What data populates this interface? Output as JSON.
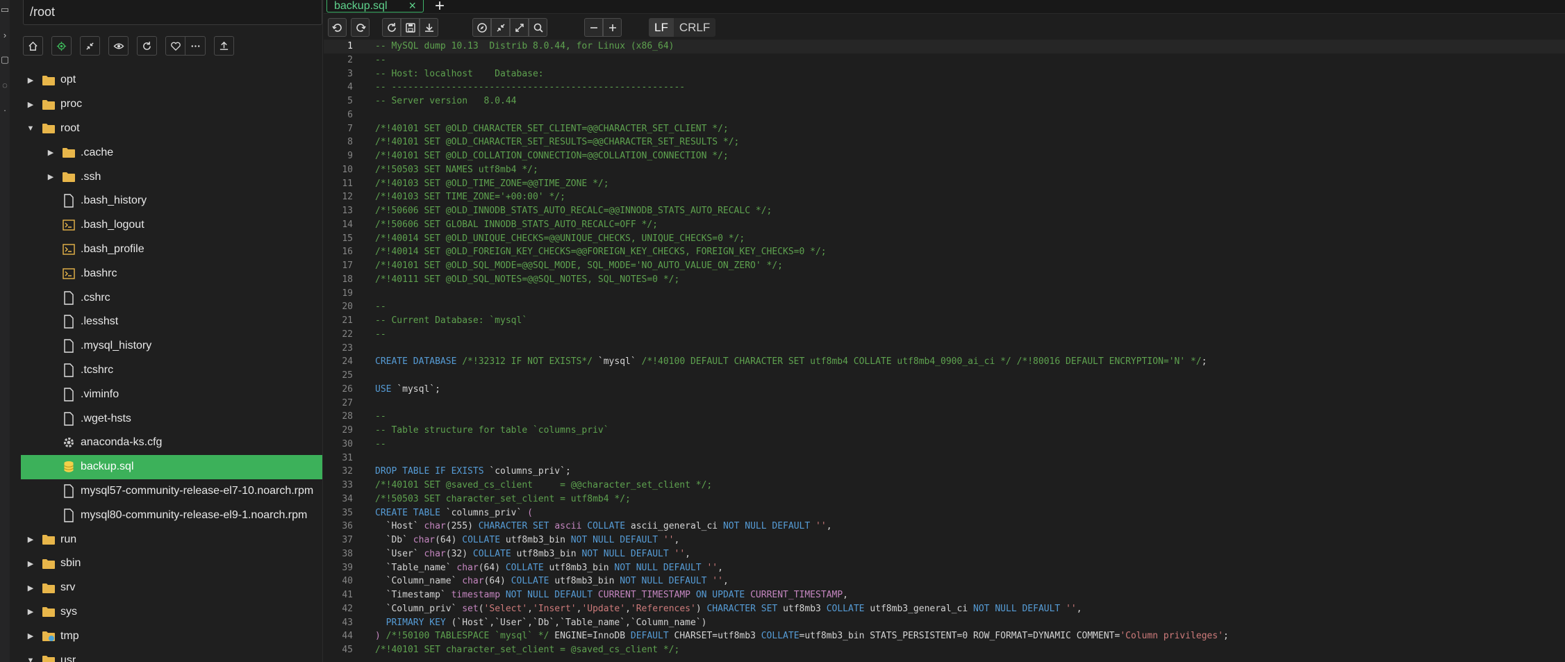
{
  "sidebar": {
    "path": "/root",
    "toolbar": [
      {
        "name": "home-icon",
        "glyph": "home"
      },
      {
        "name": "locate-icon",
        "glyph": "target"
      },
      {
        "name": "collapse-icon",
        "glyph": "collapse"
      },
      {
        "name": "eye-icon",
        "glyph": "eye"
      },
      {
        "name": "refresh-icon",
        "glyph": "refresh"
      },
      {
        "name": "heart-icon",
        "glyph": "heart"
      },
      {
        "name": "more-icon",
        "glyph": "more"
      },
      {
        "name": "upload-icon",
        "glyph": "upload"
      }
    ],
    "tree": [
      {
        "label": "opt",
        "type": "folder",
        "depth": 0,
        "expanded": false
      },
      {
        "label": "proc",
        "type": "folder",
        "depth": 0,
        "expanded": false
      },
      {
        "label": "root",
        "type": "folder",
        "depth": 0,
        "expanded": true
      },
      {
        "label": ".cache",
        "type": "folder",
        "depth": 1,
        "expanded": false
      },
      {
        "label": ".ssh",
        "type": "folder",
        "depth": 1,
        "expanded": false
      },
      {
        "label": ".bash_history",
        "type": "file",
        "depth": 1
      },
      {
        "label": ".bash_logout",
        "type": "shell",
        "depth": 1
      },
      {
        "label": ".bash_profile",
        "type": "shell",
        "depth": 1
      },
      {
        "label": ".bashrc",
        "type": "shell",
        "depth": 1
      },
      {
        "label": ".cshrc",
        "type": "file",
        "depth": 1
      },
      {
        "label": ".lesshst",
        "type": "file",
        "depth": 1
      },
      {
        "label": ".mysql_history",
        "type": "file",
        "depth": 1
      },
      {
        "label": ".tcshrc",
        "type": "file",
        "depth": 1
      },
      {
        "label": ".viminfo",
        "type": "file",
        "depth": 1
      },
      {
        "label": ".wget-hsts",
        "type": "file",
        "depth": 1
      },
      {
        "label": "anaconda-ks.cfg",
        "type": "config",
        "depth": 1
      },
      {
        "label": "backup.sql",
        "type": "database",
        "depth": 1,
        "selected": true
      },
      {
        "label": "mysql57-community-release-el7-10.noarch.rpm",
        "type": "file",
        "depth": 1
      },
      {
        "label": "mysql80-community-release-el9-1.noarch.rpm",
        "type": "file",
        "depth": 1
      },
      {
        "label": "run",
        "type": "folder",
        "depth": 0,
        "expanded": false
      },
      {
        "label": "sbin",
        "type": "folder",
        "depth": 0,
        "expanded": false
      },
      {
        "label": "srv",
        "type": "folder",
        "depth": 0,
        "expanded": false
      },
      {
        "label": "sys",
        "type": "folder",
        "depth": 0,
        "expanded": false
      },
      {
        "label": "tmp",
        "type": "folder-special",
        "depth": 0,
        "expanded": false
      },
      {
        "label": "usr",
        "type": "folder",
        "depth": 0,
        "expanded": true
      }
    ]
  },
  "editor": {
    "tab": {
      "label": "backup.sql"
    },
    "eol": {
      "lf": "LF",
      "crlf": "CRLF",
      "active": "LF"
    },
    "current_line": 1,
    "lines": [
      [
        [
          "c",
          "-- MySQL dump 10.13  Distrib 8.0.44, for Linux (x86_64)"
        ]
      ],
      [
        [
          "c",
          "--"
        ]
      ],
      [
        [
          "c",
          "-- Host: localhost    Database:"
        ]
      ],
      [
        [
          "c",
          "-- ------------------------------------------------------"
        ]
      ],
      [
        [
          "c",
          "-- Server version   8.0.44"
        ]
      ],
      [],
      [
        [
          "c",
          "/*!40101 SET @OLD_CHARACTER_SET_CLIENT=@@CHARACTER_SET_CLIENT */;"
        ]
      ],
      [
        [
          "c",
          "/*!40101 SET @OLD_CHARACTER_SET_RESULTS=@@CHARACTER_SET_RESULTS */;"
        ]
      ],
      [
        [
          "c",
          "/*!40101 SET @OLD_COLLATION_CONNECTION=@@COLLATION_CONNECTION */;"
        ]
      ],
      [
        [
          "c",
          "/*!50503 SET NAMES utf8mb4 */;"
        ]
      ],
      [
        [
          "c",
          "/*!40103 SET @OLD_TIME_ZONE=@@TIME_ZONE */;"
        ]
      ],
      [
        [
          "c",
          "/*!40103 SET TIME_ZONE='+00:00' */;"
        ]
      ],
      [
        [
          "c",
          "/*!50606 SET @OLD_INNODB_STATS_AUTO_RECALC=@@INNODB_STATS_AUTO_RECALC */;"
        ]
      ],
      [
        [
          "c",
          "/*!50606 SET GLOBAL INNODB_STATS_AUTO_RECALC=OFF */;"
        ]
      ],
      [
        [
          "c",
          "/*!40014 SET @OLD_UNIQUE_CHECKS=@@UNIQUE_CHECKS, UNIQUE_CHECKS=0 */;"
        ]
      ],
      [
        [
          "c",
          "/*!40014 SET @OLD_FOREIGN_KEY_CHECKS=@@FOREIGN_KEY_CHECKS, FOREIGN_KEY_CHECKS=0 */;"
        ]
      ],
      [
        [
          "c",
          "/*!40101 SET @OLD_SQL_MODE=@@SQL_MODE, SQL_MODE='NO_AUTO_VALUE_ON_ZERO' */;"
        ]
      ],
      [
        [
          "c",
          "/*!40111 SET @OLD_SQL_NOTES=@@SQL_NOTES, SQL_NOTES=0 */;"
        ]
      ],
      [],
      [
        [
          "c",
          "--"
        ]
      ],
      [
        [
          "c",
          "-- Current Database: `mysql`"
        ]
      ],
      [
        [
          "c",
          "--"
        ]
      ],
      [],
      [
        [
          "k",
          "CREATE DATABASE "
        ],
        [
          "c",
          "/*!32312 IF NOT EXISTS*/ "
        ],
        [
          "t",
          "`mysql` "
        ],
        [
          "c",
          "/*!40100 DEFAULT CHARACTER SET utf8mb4 COLLATE utf8mb4_0900_ai_ci */ /*!80016 DEFAULT ENCRYPTION='N' */"
        ],
        [
          "t",
          ";"
        ]
      ],
      [],
      [
        [
          "k",
          "USE "
        ],
        [
          "t",
          "`mysql`;"
        ]
      ],
      [],
      [
        [
          "c",
          "--"
        ]
      ],
      [
        [
          "c",
          "-- Table structure for table `columns_priv`"
        ]
      ],
      [
        [
          "c",
          "--"
        ]
      ],
      [],
      [
        [
          "k",
          "DROP TABLE IF EXISTS "
        ],
        [
          "t",
          "`columns_priv`;"
        ]
      ],
      [
        [
          "c",
          "/*!40101 SET @saved_cs_client     = @@character_set_client */;"
        ]
      ],
      [
        [
          "c",
          "/*!50503 SET character_set_client = utf8mb4 */;"
        ]
      ],
      [
        [
          "k",
          "CREATE TABLE "
        ],
        [
          "t",
          "`columns_priv` "
        ],
        [
          "p",
          "("
        ]
      ],
      [
        [
          "t",
          "  `Host` "
        ],
        [
          "p",
          "char"
        ],
        [
          "t",
          "(255) "
        ],
        [
          "k",
          "CHARACTER SET "
        ],
        [
          "p",
          "ascii "
        ],
        [
          "k",
          "COLLATE "
        ],
        [
          "t",
          "ascii_general_ci "
        ],
        [
          "k",
          "NOT NULL DEFAULT "
        ],
        [
          "s",
          "''"
        ],
        [
          "t",
          ","
        ]
      ],
      [
        [
          "t",
          "  `Db` "
        ],
        [
          "p",
          "char"
        ],
        [
          "t",
          "(64) "
        ],
        [
          "k",
          "COLLATE "
        ],
        [
          "t",
          "utf8mb3_bin "
        ],
        [
          "k",
          "NOT NULL DEFAULT "
        ],
        [
          "s",
          "''"
        ],
        [
          "t",
          ","
        ]
      ],
      [
        [
          "t",
          "  `User` "
        ],
        [
          "p",
          "char"
        ],
        [
          "t",
          "(32) "
        ],
        [
          "k",
          "COLLATE "
        ],
        [
          "t",
          "utf8mb3_bin "
        ],
        [
          "k",
          "NOT NULL DEFAULT "
        ],
        [
          "s",
          "''"
        ],
        [
          "t",
          ","
        ]
      ],
      [
        [
          "t",
          "  `Table_name` "
        ],
        [
          "p",
          "char"
        ],
        [
          "t",
          "(64) "
        ],
        [
          "k",
          "COLLATE "
        ],
        [
          "t",
          "utf8mb3_bin "
        ],
        [
          "k",
          "NOT NULL DEFAULT "
        ],
        [
          "s",
          "''"
        ],
        [
          "t",
          ","
        ]
      ],
      [
        [
          "t",
          "  `Column_name` "
        ],
        [
          "p",
          "char"
        ],
        [
          "t",
          "(64) "
        ],
        [
          "k",
          "COLLATE "
        ],
        [
          "t",
          "utf8mb3_bin "
        ],
        [
          "k",
          "NOT NULL DEFAULT "
        ],
        [
          "s",
          "''"
        ],
        [
          "t",
          ","
        ]
      ],
      [
        [
          "t",
          "  `Timestamp` "
        ],
        [
          "p",
          "timestamp "
        ],
        [
          "k",
          "NOT NULL DEFAULT "
        ],
        [
          "p",
          "CURRENT_TIMESTAMP "
        ],
        [
          "k",
          "ON UPDATE "
        ],
        [
          "p",
          "CURRENT_TIMESTAMP"
        ],
        [
          "t",
          ","
        ]
      ],
      [
        [
          "t",
          "  `Column_priv` "
        ],
        [
          "p",
          "set"
        ],
        [
          "t",
          "("
        ],
        [
          "s",
          "'Select'"
        ],
        [
          "t",
          ","
        ],
        [
          "s",
          "'Insert'"
        ],
        [
          "t",
          ","
        ],
        [
          "s",
          "'Update'"
        ],
        [
          "t",
          ","
        ],
        [
          "s",
          "'References'"
        ],
        [
          "t",
          ") "
        ],
        [
          "k",
          "CHARACTER SET "
        ],
        [
          "t",
          "utf8mb3 "
        ],
        [
          "k",
          "COLLATE "
        ],
        [
          "t",
          "utf8mb3_general_ci "
        ],
        [
          "k",
          "NOT NULL DEFAULT "
        ],
        [
          "s",
          "''"
        ],
        [
          "t",
          ","
        ]
      ],
      [
        [
          "k",
          "  PRIMARY KEY "
        ],
        [
          "t",
          "(`Host`,`User`,`Db`,`Table_name`,`Column_name`)"
        ]
      ],
      [
        [
          "p",
          ") "
        ],
        [
          "c",
          "/*!50100 TABLESPACE `mysql` */ "
        ],
        [
          "t",
          "ENGINE=InnoDB "
        ],
        [
          "k",
          "DEFAULT "
        ],
        [
          "t",
          "CHARSET=utf8mb3 "
        ],
        [
          "k",
          "COLLATE"
        ],
        [
          "t",
          "=utf8mb3_bin STATS_PERSISTENT=0 ROW_FORMAT=DYNAMIC COMMENT="
        ],
        [
          "s",
          "'Column privileges'"
        ],
        [
          "t",
          ";"
        ]
      ],
      [
        [
          "c",
          "/*!40101 SET character_set_client = @saved_cs_client */;"
        ]
      ]
    ]
  },
  "colors": {
    "accent": "#3cb15a",
    "folder": "#e8b64a",
    "comment": "#5ea24f",
    "keyword": "#569cd6",
    "purple": "#c586c0",
    "string": "#ce7b7b"
  }
}
